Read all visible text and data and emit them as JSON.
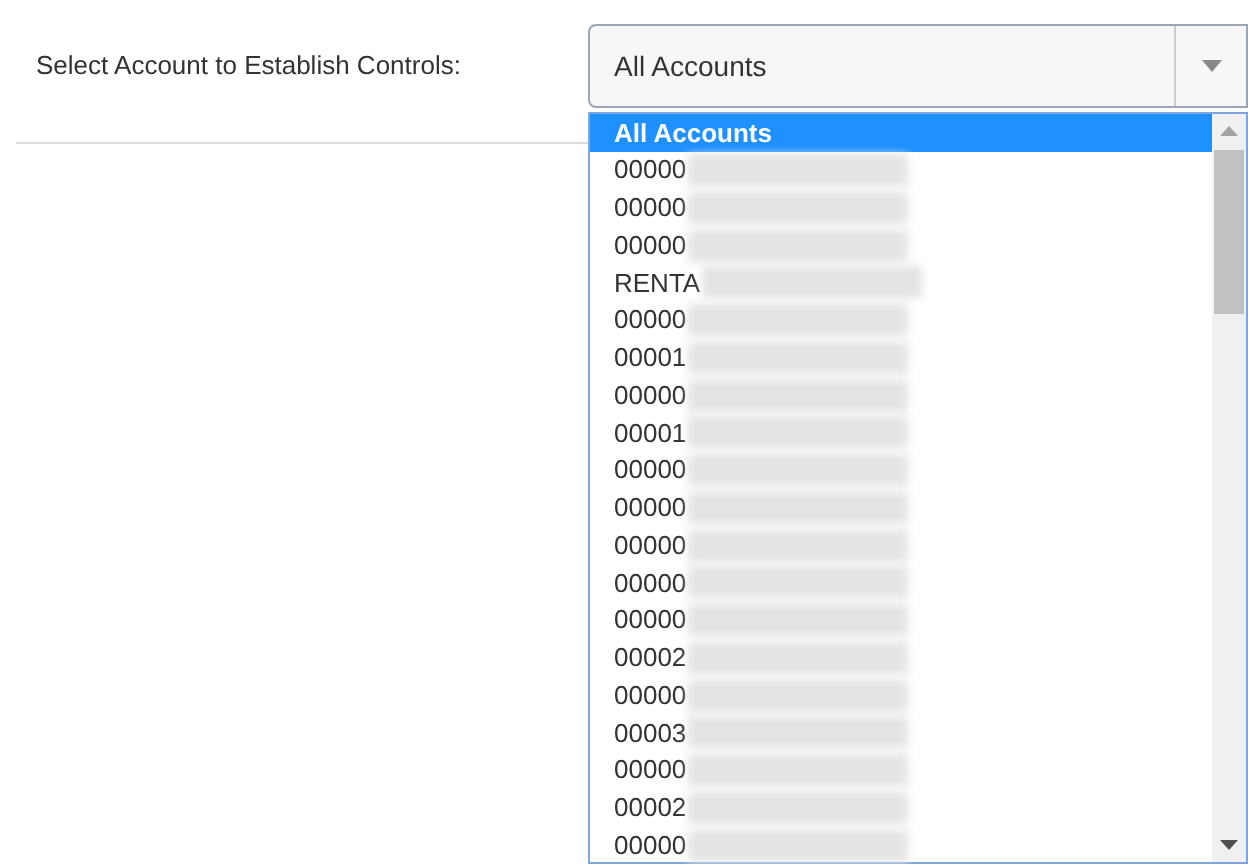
{
  "label": "Select Account to Establish Controls:",
  "select": {
    "value": "All Accounts"
  },
  "options": [
    {
      "label": "All Accounts",
      "selected": true,
      "redacted": false
    },
    {
      "label": "00000",
      "selected": false,
      "redacted": true
    },
    {
      "label": "00000",
      "selected": false,
      "redacted": true
    },
    {
      "label": "00000",
      "selected": false,
      "redacted": true
    },
    {
      "label": "RENTA",
      "selected": false,
      "redacted": true
    },
    {
      "label": "00000",
      "selected": false,
      "redacted": true
    },
    {
      "label": "00001",
      "selected": false,
      "redacted": true
    },
    {
      "label": "00000",
      "selected": false,
      "redacted": true
    },
    {
      "label": "00001",
      "selected": false,
      "redacted": true
    },
    {
      "label": "00000",
      "selected": false,
      "redacted": true
    },
    {
      "label": "00000",
      "selected": false,
      "redacted": true
    },
    {
      "label": "00000",
      "selected": false,
      "redacted": true
    },
    {
      "label": "00000",
      "selected": false,
      "redacted": true
    },
    {
      "label": "00000",
      "selected": false,
      "redacted": true
    },
    {
      "label": "00002",
      "selected": false,
      "redacted": true
    },
    {
      "label": "00000",
      "selected": false,
      "redacted": true
    },
    {
      "label": "00003",
      "selected": false,
      "redacted": true
    },
    {
      "label": "00000",
      "selected": false,
      "redacted": true
    },
    {
      "label": "00002",
      "selected": false,
      "redacted": true
    },
    {
      "label": "00000",
      "selected": false,
      "redacted": true
    }
  ]
}
